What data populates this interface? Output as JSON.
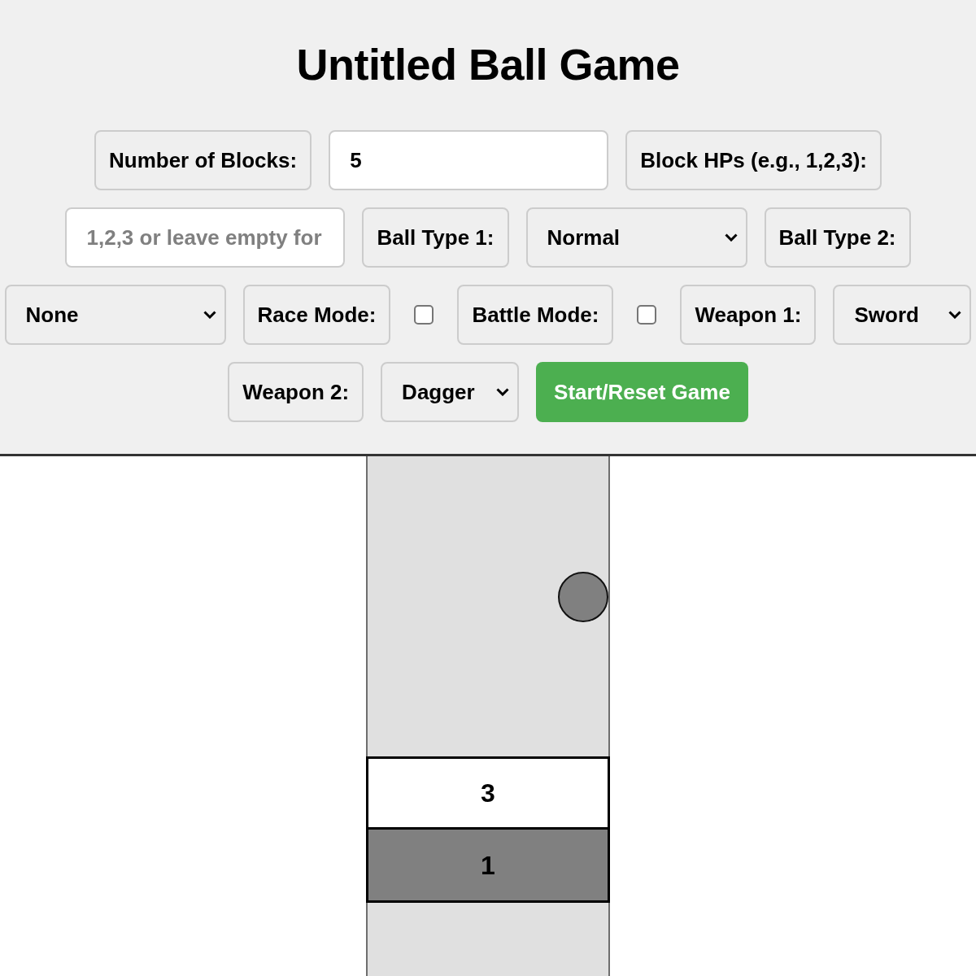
{
  "title": "Untitled Ball Game",
  "control_rows": [
    [
      {
        "kind": "label",
        "text": "Number of Blocks:"
      },
      {
        "kind": "input",
        "value": "5"
      },
      {
        "kind": "label",
        "text": "Block HPs (e.g., 1,2,3):"
      }
    ],
    [
      {
        "kind": "input",
        "placeholder": "1,2,3 or leave empty for"
      },
      {
        "kind": "label",
        "text": "Ball Type 1:"
      },
      {
        "kind": "select",
        "value": "Normal"
      },
      {
        "kind": "label",
        "text": "Ball Type 2:"
      }
    ],
    [
      {
        "kind": "select",
        "value": "None"
      },
      {
        "kind": "label",
        "text": "Race Mode:"
      },
      {
        "kind": "checkbox",
        "checked": false
      },
      {
        "kind": "label",
        "text": "Battle Mode:"
      },
      {
        "kind": "checkbox",
        "checked": false
      },
      {
        "kind": "label",
        "text": "Weapon 1:"
      },
      {
        "kind": "select",
        "value": "Sword"
      }
    ],
    [
      {
        "kind": "label",
        "text": "Weapon 2:"
      },
      {
        "kind": "select",
        "value": "Dagger"
      },
      {
        "kind": "button",
        "text": "Start/Reset Game"
      }
    ]
  ],
  "game": {
    "blocks": [
      {
        "hp": "3",
        "color": "#ffffff"
      },
      {
        "hp": "1",
        "color": "#808080"
      }
    ]
  }
}
